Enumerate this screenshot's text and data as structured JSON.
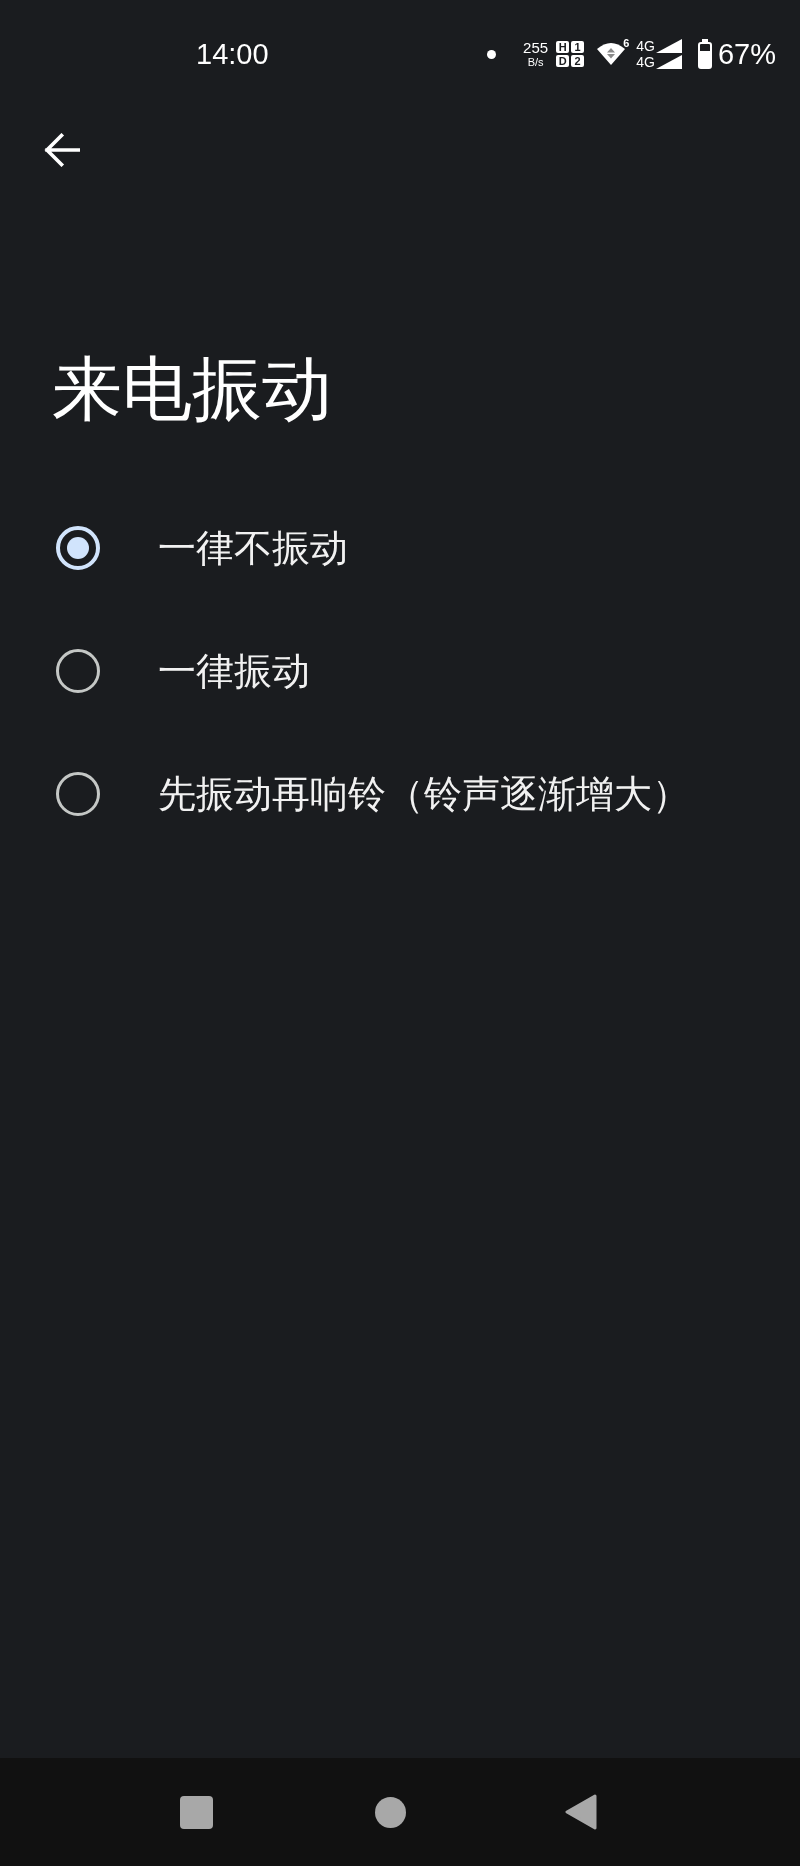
{
  "status_bar": {
    "time": "14:00",
    "data_speed": "255",
    "data_speed_unit": "B/s",
    "hd_voice": [
      {
        "letter": "H",
        "sim": "1"
      },
      {
        "letter": "D",
        "sim": "2"
      }
    ],
    "wifi_standard": "6",
    "mobile_networks": [
      "4G",
      "4G"
    ],
    "battery": "67%"
  },
  "title": "来电振动",
  "options": [
    {
      "label": "一律不振动",
      "selected": true
    },
    {
      "label": "一律振动",
      "selected": false
    },
    {
      "label": "先振动再响铃（铃声逐渐增大）",
      "selected": false
    }
  ]
}
